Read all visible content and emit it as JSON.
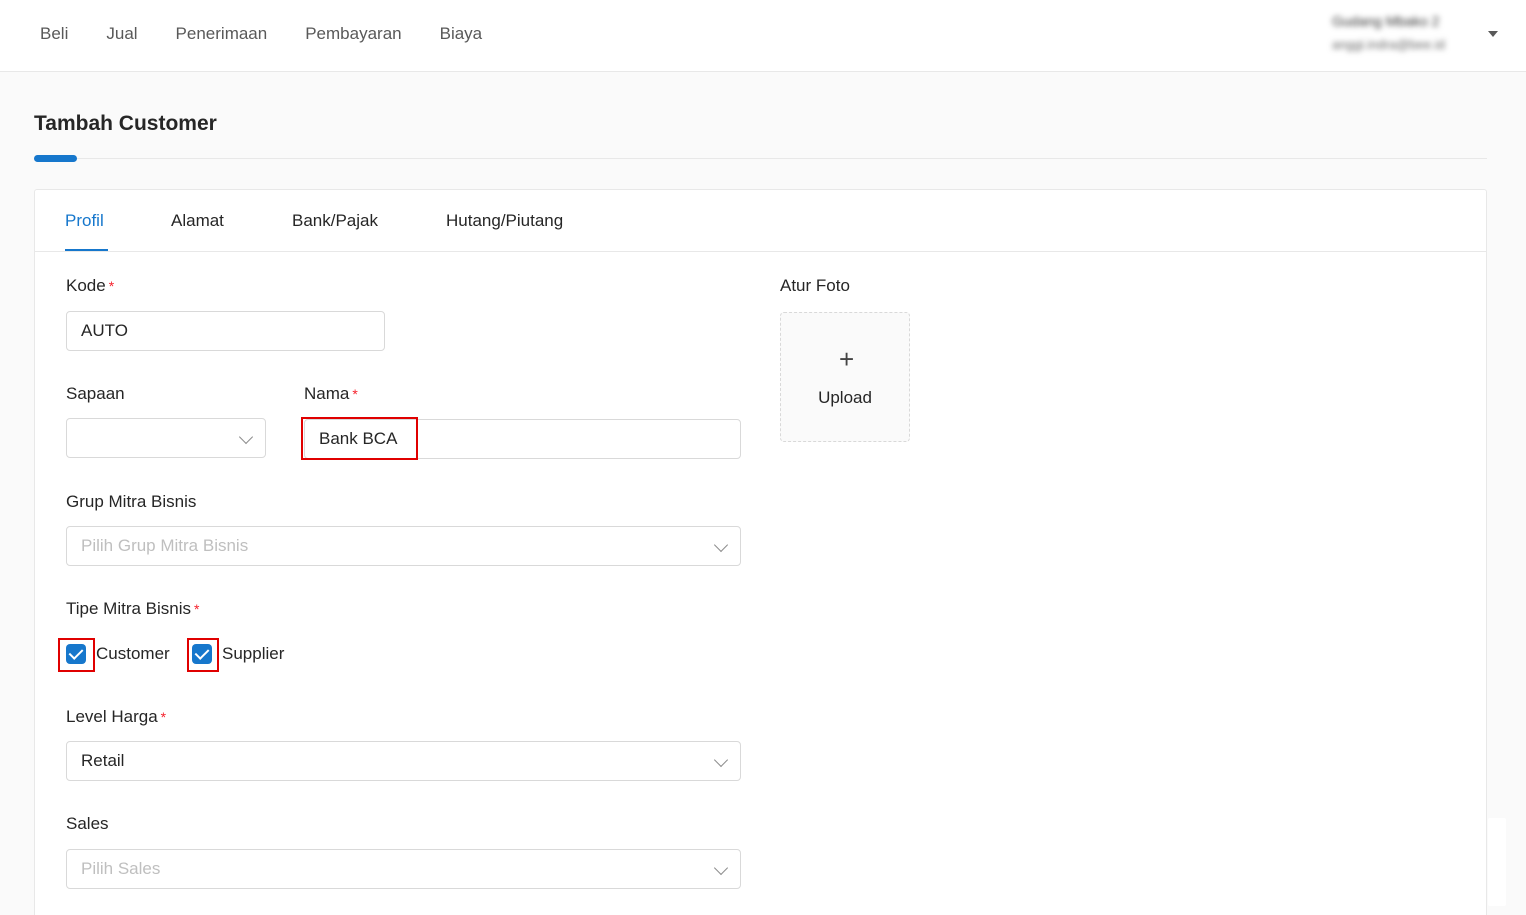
{
  "nav": {
    "items": [
      "Beli",
      "Jual",
      "Penerimaan",
      "Pembayaran",
      "Biaya"
    ]
  },
  "user": {
    "name": "Gudang Mbako 2",
    "email": "anggi.indra@bee.id"
  },
  "page": {
    "title": "Tambah Customer"
  },
  "tabs": [
    "Profil",
    "Alamat",
    "Bank/Pajak",
    "Hutang/Piutang"
  ],
  "active_tab": "Profil",
  "form": {
    "kode": {
      "label": "Kode",
      "value": "AUTO"
    },
    "sapaan": {
      "label": "Sapaan",
      "value": ""
    },
    "nama": {
      "label": "Nama",
      "value": "Bank BCA"
    },
    "grup": {
      "label": "Grup Mitra Bisnis",
      "placeholder": "Pilih Grup Mitra Bisnis"
    },
    "tipe": {
      "label": "Tipe Mitra Bisnis",
      "options": [
        {
          "label": "Customer",
          "checked": true
        },
        {
          "label": "Supplier",
          "checked": true
        }
      ]
    },
    "level_harga": {
      "label": "Level Harga",
      "value": "Retail"
    },
    "sales": {
      "label": "Sales",
      "placeholder": "Pilih Sales"
    },
    "required_mark": "*"
  },
  "photo": {
    "label": "Atur Foto",
    "plus": "+",
    "upload": "Upload"
  },
  "colors": {
    "accent": "#1677cc",
    "highlight": "#e00000",
    "required": "#f5222d"
  }
}
